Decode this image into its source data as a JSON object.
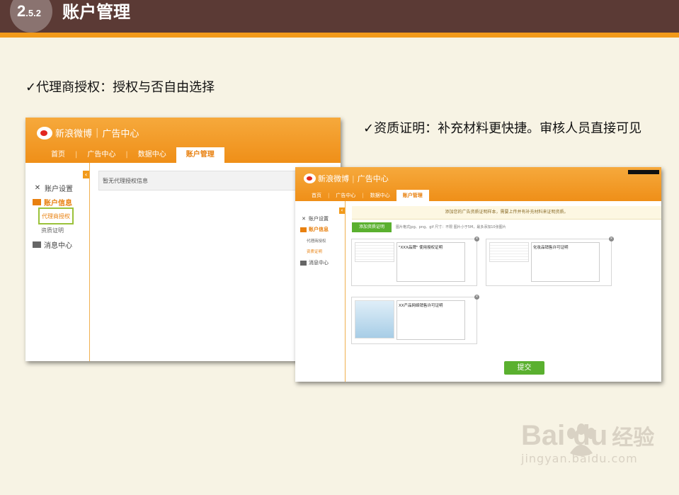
{
  "header": {
    "section_number": "2",
    "section_sub": ".5.2",
    "title": "账户管理"
  },
  "captions": {
    "agent_auth": "✓代理商授权：授权与否自由选择",
    "qualification": "✓资质证明：补充材料更快捷。审核人员直接可见"
  },
  "brand": {
    "name": "新浪微博",
    "divider": "|",
    "product": "广告中心"
  },
  "nav": [
    "首页",
    "广告中心",
    "数据中心",
    "账户管理"
  ],
  "nav_separator": "|",
  "sidebar": {
    "settings": "账户设置",
    "info": "账户信息",
    "agent_auth": "代理商授权",
    "qualification": "资质证明",
    "messages": "消息中心"
  },
  "panel1": {
    "empty_message": "暂无代理授权信息"
  },
  "panel2": {
    "notice": "添加您的广告资质证明样本，需要上传并有补充材料来证明资质。",
    "add_button": "添加资质证明",
    "add_hint": "图片格式jpg、png、gif  尺寸：不限  图片小于5M，最多添加10张图片",
    "cards": [
      {
        "desc": "\"XXX品牌\" 使用授权证明"
      },
      {
        "desc": "化妆品销售许可证明"
      },
      {
        "desc": "XX产品网络销售许可证明"
      }
    ],
    "close_icon": "×",
    "submit": "提交"
  },
  "watermark": {
    "logo": "Bai du",
    "sub": "jingyan.baidu.com",
    "label": "经验"
  },
  "colors": {
    "topbar": "#5b3a35",
    "accent": "#f29a1a",
    "green": "#5ab02f"
  }
}
